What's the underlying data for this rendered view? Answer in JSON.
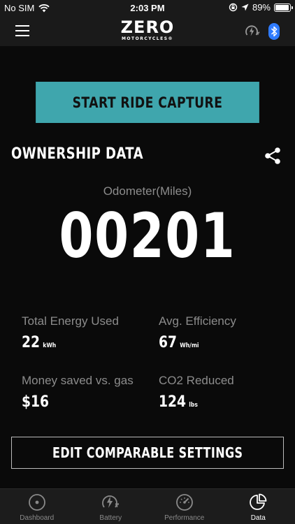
{
  "status_bar": {
    "carrier": "No SIM",
    "time": "2:03 PM",
    "battery": "89%",
    "battery_level": 0.89
  },
  "nav": {
    "logo_main": "ZERO",
    "logo_sub": "MOTORCYCLES®",
    "icons": [
      "menu-icon",
      "charging-icon",
      "bluetooth-icon"
    ],
    "bluetooth_color": "#2f7bff"
  },
  "main": {
    "start_ride_label": "START RIDE CAPTURE",
    "accent_color": "#3fa6ad",
    "section_title": "OWNERSHIP DATA",
    "odometer_label": "Odometer(Miles)",
    "odometer_value": "00201",
    "stats": [
      {
        "label": "Total Energy Used",
        "value": "22",
        "unit": "kWh"
      },
      {
        "label": "Avg. Efficiency",
        "value": "67",
        "unit": "Wh/mi"
      },
      {
        "label": "Money saved vs. gas",
        "value": "$16",
        "unit": ""
      },
      {
        "label": "CO2 Reduced",
        "value": "124",
        "unit": "lbs"
      }
    ],
    "edit_label": "EDIT COMPARABLE SETTINGS"
  },
  "tabbar": {
    "tabs": [
      {
        "label": "Dashboard",
        "icon": "dashboard-icon"
      },
      {
        "label": "Battery",
        "icon": "battery-bolt-icon"
      },
      {
        "label": "Performance",
        "icon": "gauge-icon"
      },
      {
        "label": "Data",
        "icon": "pie-chart-icon"
      }
    ],
    "active": "Data"
  }
}
